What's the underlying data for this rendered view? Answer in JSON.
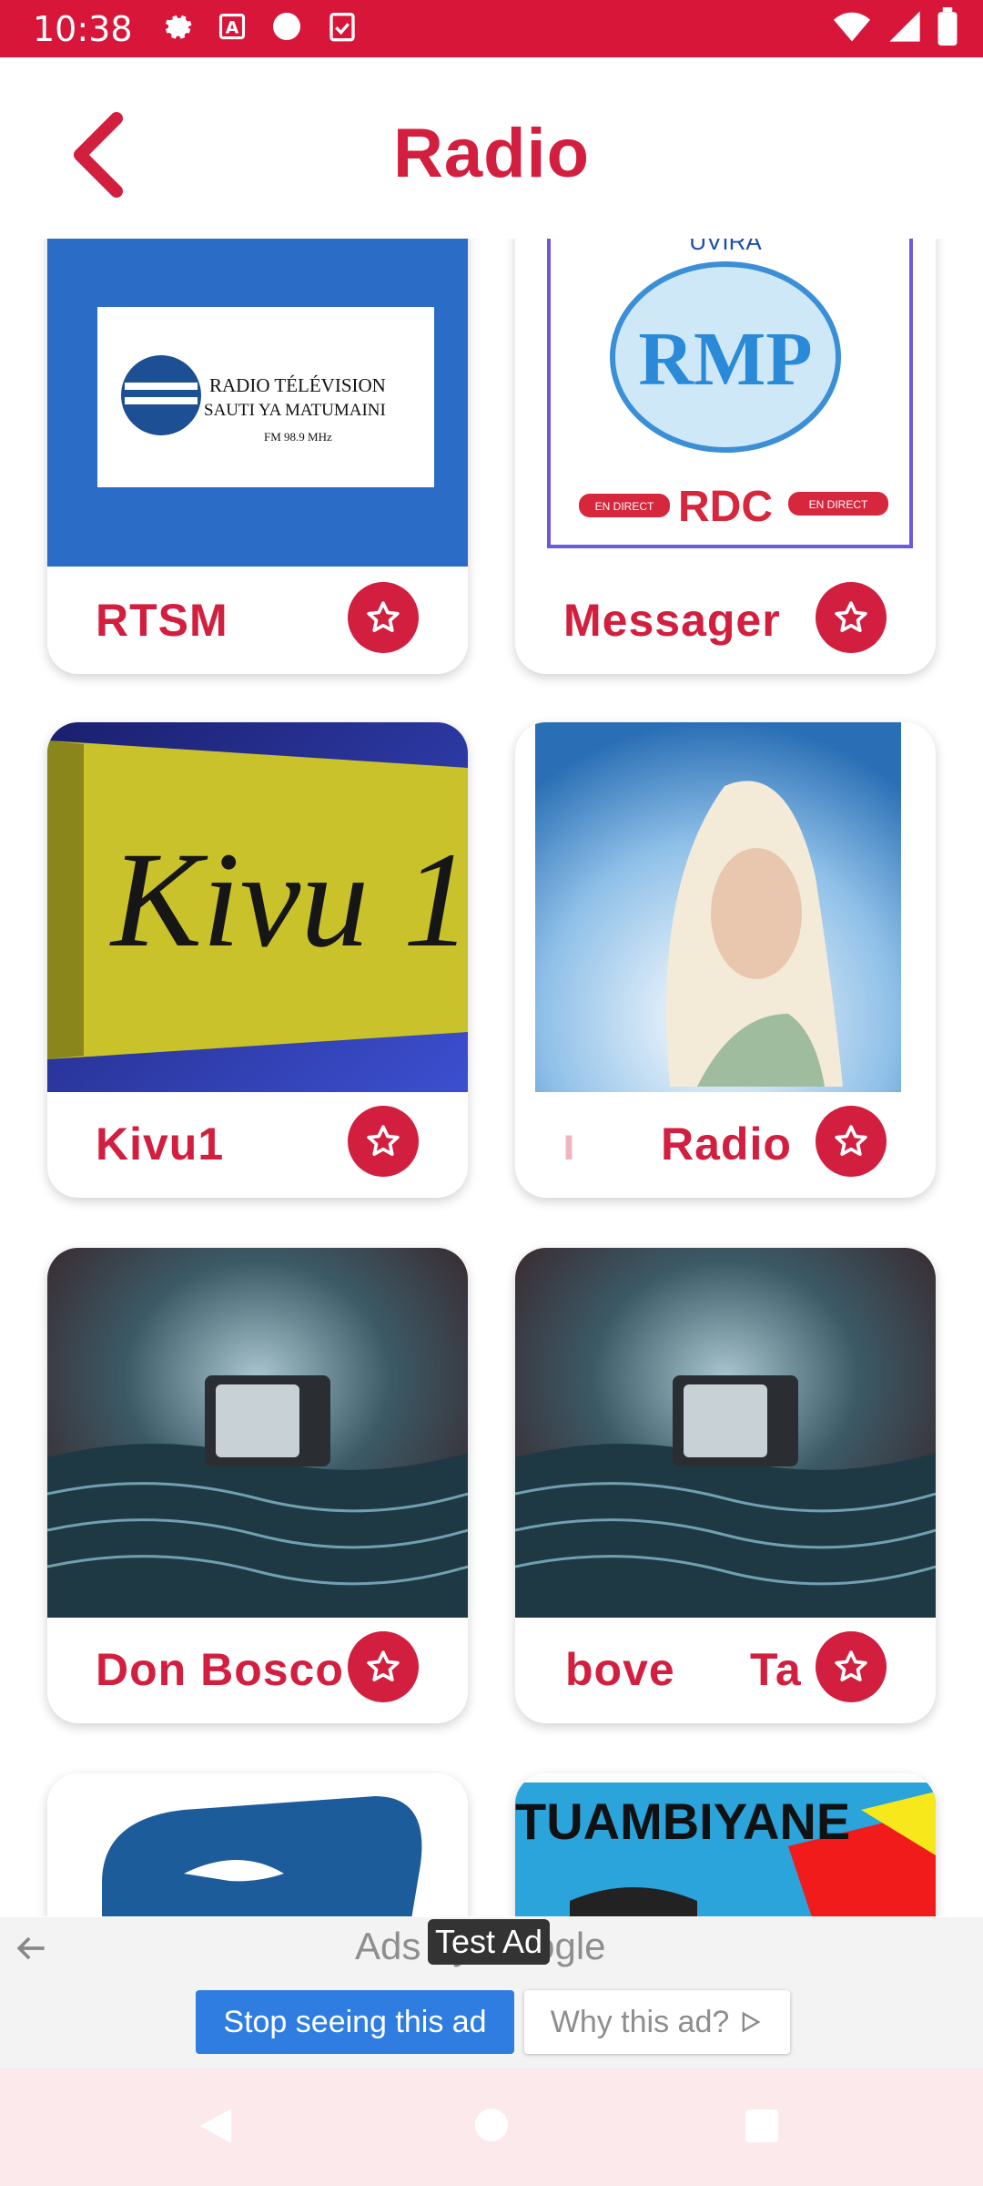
{
  "status_bar": {
    "time": "10:38",
    "icons": [
      "settings-icon",
      "font-icon",
      "circle-icon",
      "clipboard-check-icon"
    ],
    "right_icons": [
      "wifi-icon",
      "signal-icon",
      "battery-icon"
    ]
  },
  "app_bar": {
    "title": "Radio",
    "back_icon": "chevron-left-icon"
  },
  "colors": {
    "primary": "#d21f3f",
    "status_bar": "#d8163a",
    "ad_button": "#2f7de1",
    "nav_bar": "#fbe9eb"
  },
  "stations": [
    {
      "name": "RTSM",
      "logo_text": [
        "RADIO TÉLÉVISION",
        "SAUTI YA MATUMAINI",
        "FM 98.9 MHz"
      ]
    },
    {
      "name": "Messager",
      "logo_text": [
        "UVIRA",
        "RMP",
        "RDC",
        "EN DIRECT",
        "EN DIRECT"
      ]
    },
    {
      "name": "Kivu1",
      "logo_text": [
        "Kivu 1"
      ]
    },
    {
      "name": "Radio",
      "prefix": "ı"
    },
    {
      "name": "Don Bosco"
    },
    {
      "name": "bove",
      "suffix": "Ta"
    },
    {
      "name": ""
    },
    {
      "name": "",
      "logo_text": [
        "TUAMBIYANE"
      ]
    }
  ],
  "ad": {
    "ads_by": "Ads by Google",
    "test_label": "Test Ad",
    "stop_label": "Stop seeing this ad",
    "why_label": "Why this ad?"
  }
}
